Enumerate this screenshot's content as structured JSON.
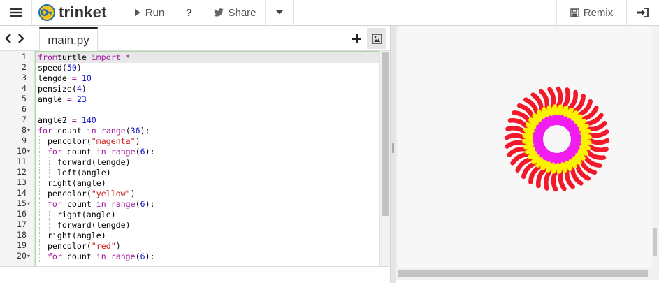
{
  "toolbar": {
    "brand": "trinket",
    "run_label": "Run",
    "help_label": "?",
    "share_label": "Share",
    "remix_label": "Remix"
  },
  "editor": {
    "file_tab": "main.py",
    "active_line": 1,
    "lines": [
      {
        "n": "1",
        "fold": "",
        "indent": 0,
        "tokens": [
          [
            "kw",
            "from"
          ],
          [
            "",
            "turtle "
          ],
          [
            "kw",
            "import"
          ],
          [
            "",
            ""
          ],
          [
            "op",
            " *"
          ]
        ]
      },
      {
        "n": "2",
        "fold": "",
        "indent": 0,
        "tokens": [
          [
            "",
            "speed("
          ],
          [
            "num",
            "50"
          ],
          [
            "",
            ")"
          ]
        ]
      },
      {
        "n": "3",
        "fold": "",
        "indent": 0,
        "tokens": [
          [
            "",
            "lengde "
          ],
          [
            "op",
            "="
          ],
          [
            "",
            ""
          ],
          [
            "num",
            " 10"
          ]
        ]
      },
      {
        "n": "4",
        "fold": "",
        "indent": 0,
        "tokens": [
          [
            "",
            "pensize("
          ],
          [
            "num",
            "4"
          ],
          [
            "",
            ")"
          ]
        ]
      },
      {
        "n": "5",
        "fold": "",
        "indent": 0,
        "tokens": [
          [
            "",
            "angle "
          ],
          [
            "op",
            "="
          ],
          [
            "num",
            " 23"
          ]
        ]
      },
      {
        "n": "6",
        "fold": "",
        "indent": 0,
        "tokens": [
          [
            "",
            ""
          ]
        ]
      },
      {
        "n": "7",
        "fold": "",
        "indent": 0,
        "tokens": [
          [
            "",
            "angle2 "
          ],
          [
            "op",
            "="
          ],
          [
            "num",
            " 140"
          ]
        ]
      },
      {
        "n": "8",
        "fold": "▾",
        "indent": 0,
        "tokens": [
          [
            "kw",
            "for"
          ],
          [
            "",
            " count "
          ],
          [
            "kw",
            "in"
          ],
          [
            "",
            ""
          ],
          [
            "kw",
            " range"
          ],
          [
            "",
            "("
          ],
          [
            "num",
            "36"
          ],
          [
            "",
            "):"
          ]
        ]
      },
      {
        "n": "9",
        "fold": "",
        "indent": 1,
        "tokens": [
          [
            "",
            "pencolor("
          ],
          [
            "str",
            "\"magenta\""
          ],
          [
            "",
            ")"
          ]
        ]
      },
      {
        "n": "10",
        "fold": "▾",
        "indent": 1,
        "tokens": [
          [
            "kw",
            "for"
          ],
          [
            "",
            " count "
          ],
          [
            "kw",
            "in"
          ],
          [
            "kw",
            " range"
          ],
          [
            "",
            "("
          ],
          [
            "num",
            "6"
          ],
          [
            "",
            "):"
          ]
        ]
      },
      {
        "n": "11",
        "fold": "",
        "indent": 2,
        "tokens": [
          [
            "",
            "forward(lengde)"
          ]
        ]
      },
      {
        "n": "12",
        "fold": "",
        "indent": 2,
        "tokens": [
          [
            "",
            "left(angle)"
          ]
        ]
      },
      {
        "n": "13",
        "fold": "",
        "indent": 1,
        "tokens": [
          [
            "",
            "right(angle)"
          ]
        ]
      },
      {
        "n": "14",
        "fold": "",
        "indent": 1,
        "tokens": [
          [
            "",
            "pencolor("
          ],
          [
            "str",
            "\"yellow\""
          ],
          [
            "",
            ")"
          ]
        ]
      },
      {
        "n": "15",
        "fold": "▾",
        "indent": 1,
        "tokens": [
          [
            "kw",
            "for"
          ],
          [
            "",
            " count "
          ],
          [
            "kw",
            "in"
          ],
          [
            "kw",
            " range"
          ],
          [
            "",
            "("
          ],
          [
            "num",
            "6"
          ],
          [
            "",
            "):"
          ]
        ]
      },
      {
        "n": "16",
        "fold": "",
        "indent": 2,
        "tokens": [
          [
            "",
            "right(angle)"
          ]
        ]
      },
      {
        "n": "17",
        "fold": "",
        "indent": 2,
        "tokens": [
          [
            "",
            "forward(lengde)"
          ]
        ]
      },
      {
        "n": "18",
        "fold": "",
        "indent": 1,
        "tokens": [
          [
            "",
            "right(angle)"
          ]
        ]
      },
      {
        "n": "19",
        "fold": "",
        "indent": 1,
        "tokens": [
          [
            "",
            "pencolor("
          ],
          [
            "str",
            "\"red\""
          ],
          [
            "",
            ")"
          ]
        ]
      },
      {
        "n": "20",
        "fold": "▾",
        "indent": 1,
        "tokens": [
          [
            "kw",
            "for"
          ],
          [
            "",
            " count "
          ],
          [
            "kw",
            "in"
          ],
          [
            "kw",
            " range"
          ],
          [
            "",
            "("
          ],
          [
            "num",
            "6"
          ],
          [
            "",
            "):"
          ]
        ]
      }
    ]
  },
  "output": {
    "colors": {
      "outer": "#f21a2a",
      "middle": "#fbf200",
      "inner": "#f01cf0"
    },
    "drawing": "turtle-flower"
  },
  "icons": {
    "menu": "hamburger-icon",
    "logo": "trinket-key-icon",
    "run": "play-icon",
    "share": "twitter-bird-icon",
    "caret": "caret-down-icon",
    "remix": "floppy-disk-icon",
    "login": "sign-in-icon",
    "back": "chevron-left-icon",
    "forward": "chevron-right-icon",
    "add": "plus-icon",
    "image": "image-icon"
  }
}
